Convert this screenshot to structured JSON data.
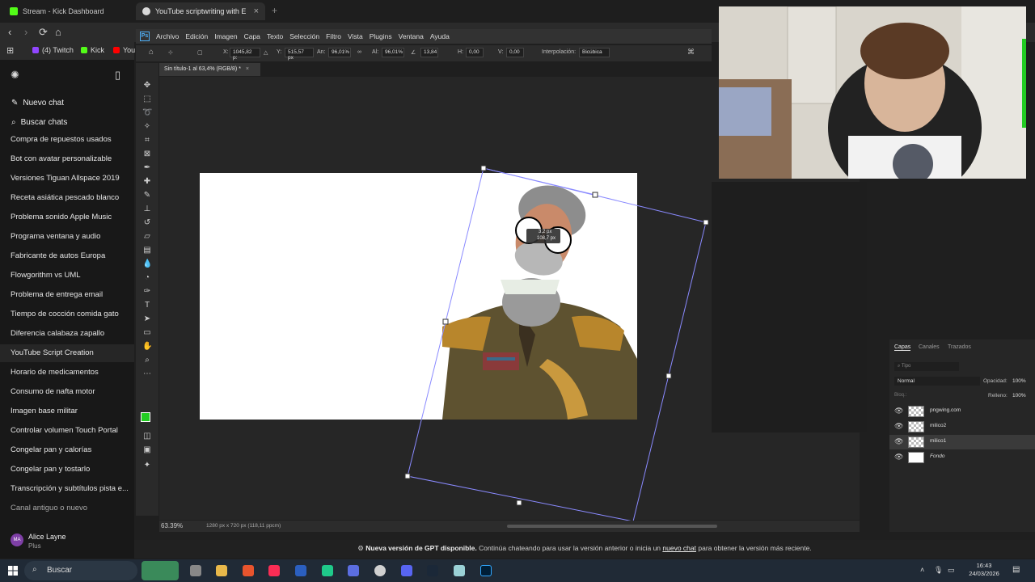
{
  "browser": {
    "tabs": [
      {
        "title": "Stream - Kick Dashboard"
      },
      {
        "title": "YouTube scriptwriting with Enga"
      }
    ],
    "bookmarks": [
      {
        "label": "(4) Twitch",
        "color": "#9146ff"
      },
      {
        "label": "Kick",
        "color": "#53fc18"
      },
      {
        "label": "You",
        "color": "#ff0000"
      }
    ]
  },
  "sidebar": {
    "new_chat": "Nuevo chat",
    "search_chats": "Buscar chats",
    "chats": [
      "Compra de repuestos usados",
      "Bot con avatar personalizable",
      "Versiones Tiguan Allspace 2019",
      "Receta asiática pescado blanco",
      "Problema sonido Apple Music",
      "Programa ventana y audio",
      "Fabricante de autos Europa",
      "Flowgorithm vs UML",
      "Problema de entrega email",
      "Tiempo de cocción comida gato",
      "Diferencia calabaza zapallo",
      "YouTube Script Creation",
      "Horario de medicamentos",
      "Consumo de nafta motor",
      "Imagen base militar",
      "Controlar volumen Touch Portal",
      "Congelar pan y calorías",
      "Congelar pan y tostarlo",
      "Transcripción y subtítulos pista e...",
      "Canal antiguo o nuevo"
    ],
    "active_index": 11,
    "user": {
      "name": "Alice Layne",
      "plan": "Plus",
      "initials": "MA"
    }
  },
  "photoshop": {
    "menu": [
      "Archivo",
      "Edición",
      "Imagen",
      "Capa",
      "Texto",
      "Selección",
      "Filtro",
      "Vista",
      "Plugins",
      "Ventana",
      "Ayuda"
    ],
    "options": {
      "x_label": "X:",
      "x_value": "1045,82 p:",
      "y_label": "Y:",
      "y_value": "515,57 px",
      "w_label": "An:",
      "w_value": "96,01%",
      "h_label": "Al:",
      "h_value": "96,01%",
      "angle_value": "13,84",
      "hskew_label": "H:",
      "hskew_value": "0,00",
      "vskew_label": "V:",
      "vskew_value": "0,00",
      "interp_label": "Interpolación:",
      "interp_value": "Bicúbica"
    },
    "doc_tab": "Sin título-1 al 63,4% (RGB/8) *",
    "transform_readout": {
      "line1": "3,2 px",
      "line2": "108,7 px"
    },
    "zoom": "63.39%",
    "doc_size": "1280 px x 720 px (118,11 ppcm)",
    "foreground_color": "#22cc22",
    "background_color": "#7a3fbf"
  },
  "layers": {
    "tabs": [
      "Capas",
      "Canales",
      "Trazados"
    ],
    "filter_placeholder": "Tipo",
    "blend_mode": "Normal",
    "opacity_label": "Opacidad:",
    "opacity_value": "100%",
    "lock_label": "Bloq.:",
    "fill_label": "Relleno:",
    "fill_value": "100%",
    "items": [
      {
        "name": "pngwing.com",
        "selected": false
      },
      {
        "name": "milico2",
        "selected": false
      },
      {
        "name": "milico1",
        "selected": true
      },
      {
        "name": "Fondo",
        "selected": false
      }
    ]
  },
  "notice": {
    "bold": "Nueva versión de GPT disponible.",
    "text_before": "Continúa chateando para usar la versión anterior o inicia un",
    "link": "nuevo chat",
    "text_after": "para obtener la versión más reciente."
  },
  "taskbar": {
    "search": "Buscar",
    "time": "16:43",
    "date": "24/03/2026"
  }
}
